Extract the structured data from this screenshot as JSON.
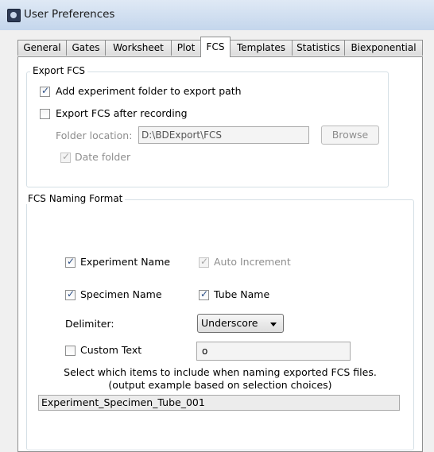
{
  "window": {
    "title": "User Preferences"
  },
  "tabs": [
    {
      "label": "General"
    },
    {
      "label": "Gates"
    },
    {
      "label": "Worksheet"
    },
    {
      "label": "Plot"
    },
    {
      "label": "FCS",
      "active": true
    },
    {
      "label": "Templates"
    },
    {
      "label": "Statistics"
    },
    {
      "label": "Biexponential"
    }
  ],
  "export_fcs": {
    "title": "Export FCS",
    "add_folder": {
      "label": "Add experiment folder to export path",
      "checked": true
    },
    "export_after": {
      "label": "Export FCS after recording",
      "checked": false
    },
    "folder_location": {
      "label": "Folder location:",
      "value": "D:\\BDExport\\FCS"
    },
    "browse_label": "Browse",
    "date_folder": {
      "label": "Date folder",
      "checked": true,
      "enabled": false
    }
  },
  "naming_format": {
    "title": "FCS Naming Format",
    "experiment_name": {
      "label": "Experiment Name",
      "checked": true
    },
    "auto_increment": {
      "label": "Auto Increment",
      "checked": true,
      "enabled": false
    },
    "specimen_name": {
      "label": "Specimen Name",
      "checked": true
    },
    "tube_name": {
      "label": "Tube Name",
      "checked": true
    },
    "delimiter": {
      "label": "Delimiter:",
      "value": "Underscore"
    },
    "custom_text": {
      "label": "Custom Text",
      "checked": false,
      "value": "o"
    },
    "help_line1": "Select which items to include when naming exported FCS files.",
    "help_line2": "(output example based on selection choices)",
    "example_output": "Experiment_Specimen_Tube_001"
  },
  "colors": {
    "title_bar": "#c4d6ec",
    "check_mark": "#2a4e86",
    "panel_background": "#ffffff",
    "window_background": "#f0f0f0"
  }
}
